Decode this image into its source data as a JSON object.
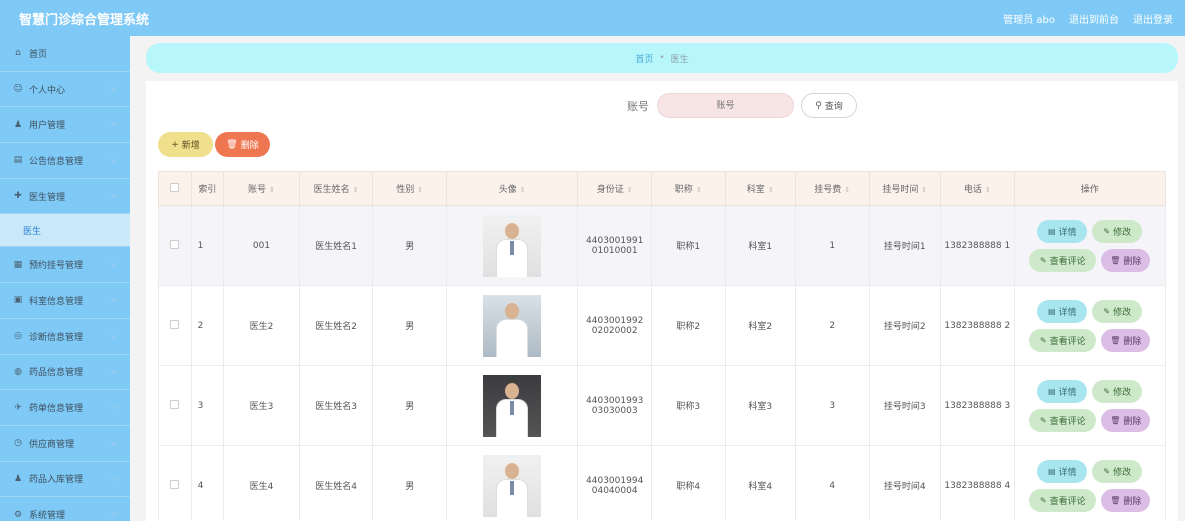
{
  "app": {
    "title": "智慧门诊综合管理系统",
    "admin": "管理员 abo",
    "back_link": "退出到前台",
    "logout": "退出登录"
  },
  "sidebar": {
    "items": [
      {
        "label": "首页",
        "icon": "home-icon",
        "glyph": "⌂"
      },
      {
        "label": "个人中心",
        "icon": "user-icon",
        "glyph": "☺"
      },
      {
        "label": "用户管理",
        "icon": "users-icon",
        "glyph": "♟"
      },
      {
        "label": "公告信息管理",
        "icon": "notice-icon",
        "glyph": "▤"
      },
      {
        "label": "医生管理",
        "icon": "doctor-icon",
        "glyph": "✚"
      },
      {
        "label": "预约挂号管理",
        "icon": "calendar-icon",
        "glyph": "▦"
      },
      {
        "label": "科室信息管理",
        "icon": "department-icon",
        "glyph": "▣"
      },
      {
        "label": "诊断信息管理",
        "icon": "diagnosis-icon",
        "glyph": "◎"
      },
      {
        "label": "药品信息管理",
        "icon": "medicine-icon",
        "glyph": "◍"
      },
      {
        "label": "药单信息管理",
        "icon": "prescription-icon",
        "glyph": "✈"
      },
      {
        "label": "供应商管理",
        "icon": "supplier-icon",
        "glyph": "◷"
      },
      {
        "label": "药品入库管理",
        "icon": "stock-icon",
        "glyph": "♟"
      },
      {
        "label": "系统管理",
        "icon": "system-icon",
        "glyph": "⚙"
      }
    ],
    "active_sub": "医生"
  },
  "breadcrumb": {
    "home": "首页",
    "current": "医生"
  },
  "search": {
    "label": "账号",
    "placeholder": "账号",
    "button": "查询"
  },
  "toolbar": {
    "add": "新增",
    "delete": "删除"
  },
  "table": {
    "headers": {
      "index": "索引",
      "account": "账号",
      "name": "医生姓名",
      "gender": "性别",
      "avatar": "头像",
      "id_card": "身份证",
      "title": "职称",
      "department": "科室",
      "fee": "挂号费",
      "time": "挂号时间",
      "phone": "电话",
      "ops": "操作"
    },
    "rows": [
      {
        "index": "1",
        "account": "001",
        "name": "医生姓名1",
        "gender": "男",
        "id_card": "4403001991 01010001",
        "title": "职称1",
        "department": "科室1",
        "fee": "1",
        "time": "挂号时间1",
        "phone": "1382388888 1"
      },
      {
        "index": "2",
        "account": "医生2",
        "name": "医生姓名2",
        "gender": "男",
        "id_card": "4403001992 02020002",
        "title": "职称2",
        "department": "科室2",
        "fee": "2",
        "time": "挂号时间2",
        "phone": "1382388888 2"
      },
      {
        "index": "3",
        "account": "医生3",
        "name": "医生姓名3",
        "gender": "男",
        "id_card": "4403001993 03030003",
        "title": "职称3",
        "department": "科室3",
        "fee": "3",
        "time": "挂号时间3",
        "phone": "1382388888 3"
      },
      {
        "index": "4",
        "account": "医生4",
        "name": "医生姓名4",
        "gender": "男",
        "id_card": "4403001994 04040004",
        "title": "职称4",
        "department": "科室4",
        "fee": "4",
        "time": "挂号时间4",
        "phone": "1382388888 4"
      }
    ],
    "row_actions": {
      "detail": "详情",
      "edit": "修改",
      "review": "查看评论",
      "delete": "删除"
    }
  },
  "colors": {
    "topbar": "#7ec9f5",
    "breadcrumb_bg": "#b7f7fb",
    "add_button": "#f0df8c",
    "delete_button": "#ee7752"
  }
}
